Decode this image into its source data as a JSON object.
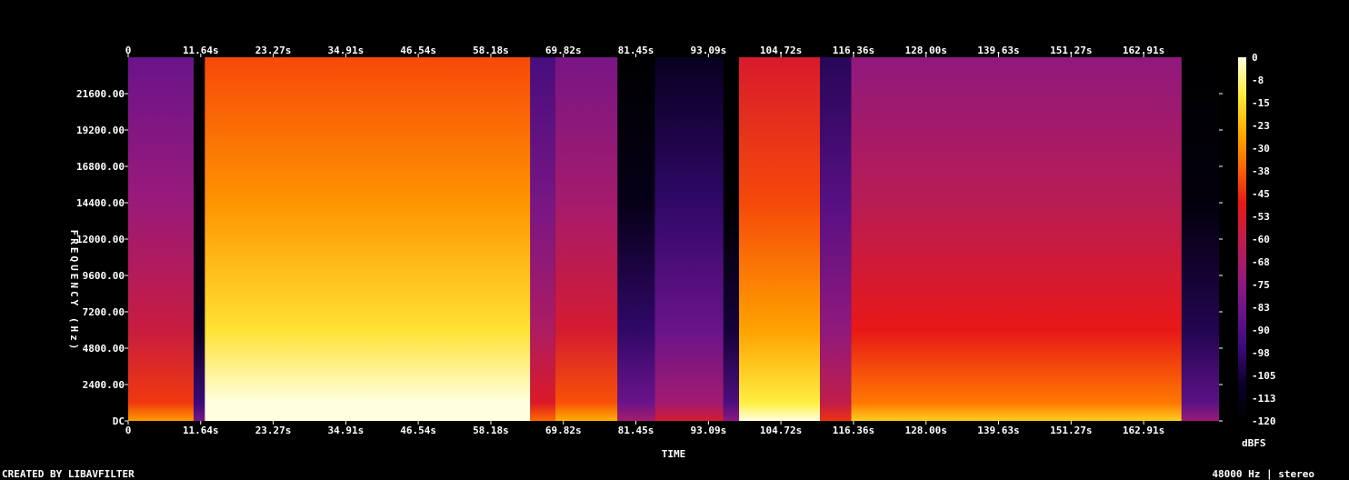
{
  "chart_data": {
    "type": "heatmap",
    "title": "",
    "xlabel": "TIME",
    "ylabel": "FREQUENCY (Hz)",
    "x_ticks": [
      "0",
      "11.64s",
      "23.27s",
      "34.91s",
      "46.54s",
      "58.18s",
      "69.82s",
      "81.45s",
      "93.09s",
      "104.72s",
      "116.36s",
      "128.00s",
      "139.63s",
      "151.27s",
      "162.91s"
    ],
    "x_tick_values": [
      0,
      11.64,
      23.27,
      34.91,
      46.54,
      58.18,
      69.82,
      81.45,
      93.09,
      104.72,
      116.36,
      128.0,
      139.63,
      151.27,
      162.91
    ],
    "xlim": [
      0,
      175
    ],
    "y_ticks": [
      "DC",
      "2400.00",
      "4800.00",
      "7200.00",
      "9600.00",
      "12000.00",
      "14400.00",
      "16800.00",
      "19200.00",
      "21600.00"
    ],
    "y_tick_values": [
      0,
      2400,
      4800,
      7200,
      9600,
      12000,
      14400,
      16800,
      19200,
      21600
    ],
    "ylim": [
      0,
      24000
    ],
    "colorbar": {
      "label": "dBFS",
      "ticks": [
        "0",
        "-8",
        "-15",
        "-23",
        "-30",
        "-38",
        "-45",
        "-53",
        "-60",
        "-68",
        "-75",
        "-83",
        "-90",
        "-98",
        "-105",
        "-113",
        "-120"
      ],
      "range": [
        -120,
        0
      ],
      "colors": [
        "#000000",
        "#0a0028",
        "#3a0a78",
        "#6a148a",
        "#9a1a7a",
        "#c01d4a",
        "#e81818",
        "#ff6a00",
        "#ffb000",
        "#ffee40",
        "#ffffe0"
      ]
    },
    "segments": [
      {
        "start": 0,
        "end": 10.5,
        "level": 0.52
      },
      {
        "start": 10.5,
        "end": 12.3,
        "level": 0.08
      },
      {
        "start": 12.3,
        "end": 64.5,
        "level": 0.88
      },
      {
        "start": 64.5,
        "end": 68.5,
        "level": 0.45
      },
      {
        "start": 68.5,
        "end": 78.5,
        "level": 0.55
      },
      {
        "start": 78.5,
        "end": 84.5,
        "level": 0.18
      },
      {
        "start": 84.5,
        "end": 95.5,
        "level": 0.3
      },
      {
        "start": 95.5,
        "end": 98.0,
        "level": 0.12
      },
      {
        "start": 98.0,
        "end": 111.0,
        "level": 0.78
      },
      {
        "start": 111.0,
        "end": 116.0,
        "level": 0.38
      },
      {
        "start": 116.0,
        "end": 169.0,
        "level": 0.6
      },
      {
        "start": 169.0,
        "end": 175.0,
        "level": 0.15
      }
    ]
  },
  "footer": {
    "left": "CREATED BY LIBAVFILTER",
    "right": "48000 Hz ∣ stereo"
  }
}
